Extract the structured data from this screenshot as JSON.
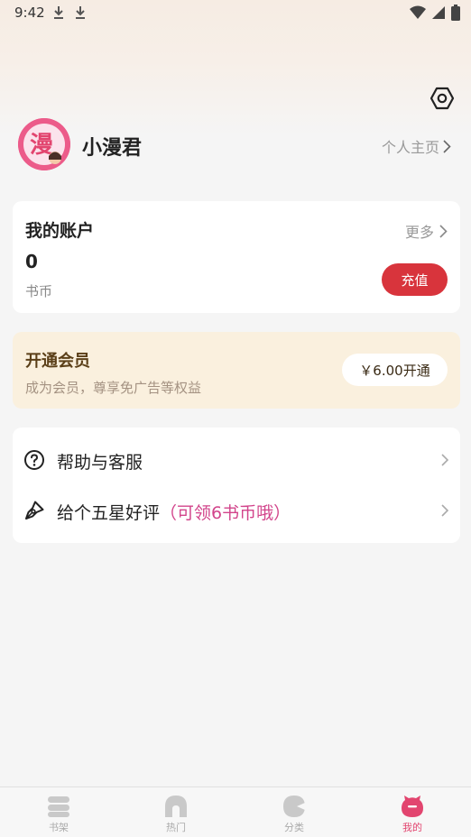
{
  "status_bar": {
    "time": "9:42"
  },
  "profile": {
    "username": "小漫君",
    "homepage_link": "个人主页",
    "avatar_glyph": "漫"
  },
  "account": {
    "title": "我的账户",
    "more": "更多",
    "balance": "0",
    "unit": "书币",
    "recharge": "充值"
  },
  "vip": {
    "title": "开通会员",
    "subtitle": "成为会员，尊享免广告等权益",
    "button": "￥6.00开通"
  },
  "menu": {
    "help": "帮助与客服",
    "rate": "给个五星好评",
    "rate_bonus": "（可领6书币哦）"
  },
  "tabs": [
    {
      "label": "书架",
      "icon": "bookshelf-icon"
    },
    {
      "label": "热门",
      "icon": "popular-icon"
    },
    {
      "label": "分类",
      "icon": "category-icon"
    },
    {
      "label": "我的",
      "icon": "mine-icon"
    }
  ],
  "colors": {
    "accent_red": "#d8343c",
    "accent_pink": "#d2448b",
    "active_tab": "#e2456f",
    "vip_bg": "#faf0de"
  }
}
